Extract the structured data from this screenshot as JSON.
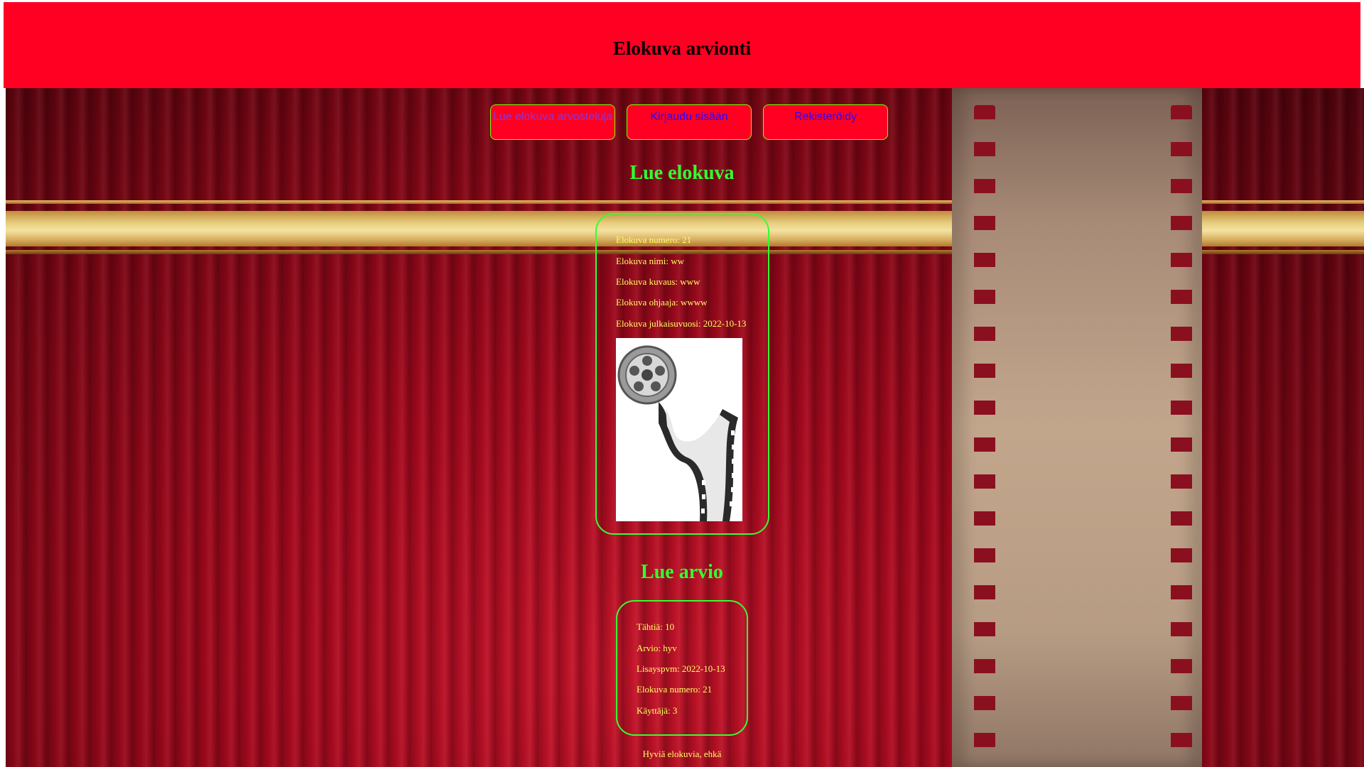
{
  "header": {
    "title": "Elokuva arvionti"
  },
  "nav": {
    "read_reviews": "Lue elokuva arvosteluja",
    "login": "Kirjaudu sisään",
    "register": "Rekisteröidy"
  },
  "movie_section": {
    "title": "Lue elokuva",
    "number": "Elokuva numero: 21",
    "name": "Elokuva nimi: ww",
    "description": "Elokuva kuvaus: www",
    "director": "Elokuva ohjaaja: wwww",
    "release": "Elokuva julkaisuvuosi: 2022-10-13",
    "poster_icon": "film-reel-icon"
  },
  "review_section": {
    "title": "Lue arvio",
    "stars": "Tähtiä: 10",
    "review": "Arvio: hyv",
    "added": "Lisayspvm: 2022-10-13",
    "movie_number": "Elokuva numero: 21",
    "user": "Käyttäjä: 3"
  },
  "footer": {
    "text": "Hyviä elokuvia, ehkä"
  },
  "colors": {
    "header_bg": "#ff0022",
    "accent_green": "#33ff33",
    "text_yellow": "#ffff66"
  }
}
